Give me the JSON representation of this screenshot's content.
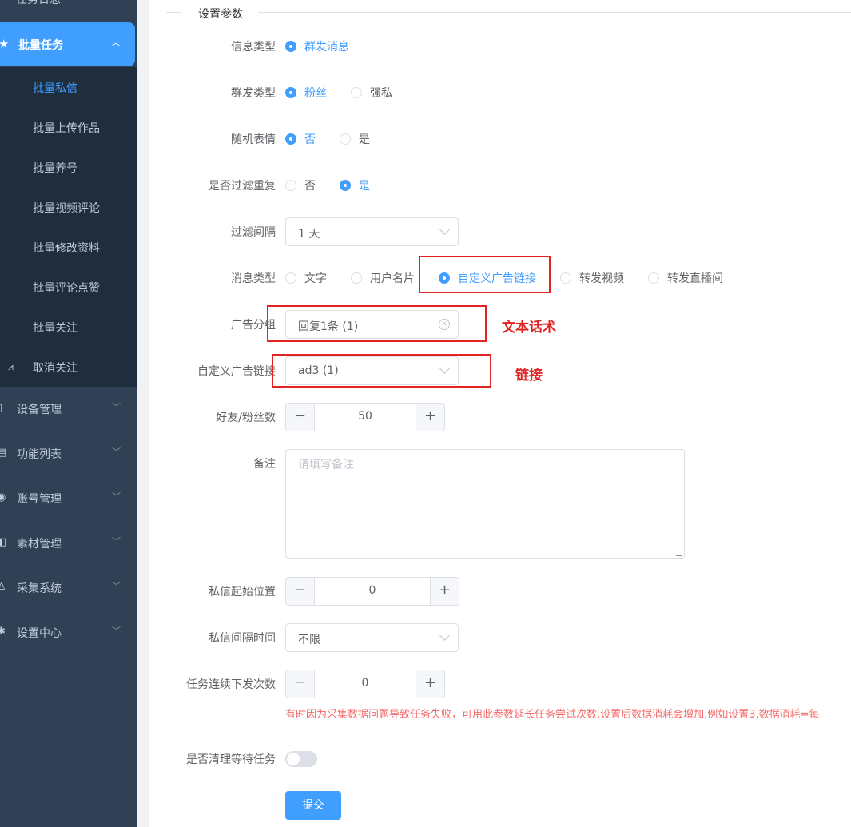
{
  "sidebar": {
    "top_item": "任务日志",
    "active_group": {
      "label": "批量任务",
      "icon": "star-icon"
    },
    "sub_items": [
      {
        "label": "批量私信",
        "current": true
      },
      {
        "label": "批量上传作品"
      },
      {
        "label": "批量养号"
      },
      {
        "label": "批量视频评论"
      },
      {
        "label": "批量修改资料"
      },
      {
        "label": "批量评论点赞"
      },
      {
        "label": "批量关注"
      },
      {
        "label": "取消关注",
        "icon": "unfollow-icon"
      }
    ],
    "groups": [
      {
        "label": "设备管理",
        "icon": "phone-icon"
      },
      {
        "label": "功能列表",
        "icon": "list-icon"
      },
      {
        "label": "账号管理",
        "icon": "user-icon"
      },
      {
        "label": "素材管理",
        "icon": "box-icon"
      },
      {
        "label": "采集系统",
        "icon": "collect-icon"
      },
      {
        "label": "设置中心",
        "icon": "gear-icon"
      }
    ]
  },
  "form": {
    "legend": "设置参数",
    "info_type": {
      "label": "信息类型",
      "options": [
        "群发消息"
      ],
      "selected": "群发消息"
    },
    "mass_type": {
      "label": "群发类型",
      "options": [
        "粉丝",
        "强私"
      ],
      "selected": "粉丝"
    },
    "random_emoji": {
      "label": "随机表情",
      "options": [
        "否",
        "是"
      ],
      "selected": "否"
    },
    "filter_repeat": {
      "label": "是否过滤重复",
      "options": [
        "否",
        "是"
      ],
      "selected": "是"
    },
    "filter_interval": {
      "label": "过滤间隔",
      "value": "1 天"
    },
    "message_type": {
      "label": "消息类型",
      "options": [
        "文字",
        "用户名片",
        "自定义广告链接",
        "转发视频",
        "转发直播间"
      ],
      "selected": "自定义广告链接"
    },
    "ad_group": {
      "label": "广告分组",
      "value": "回复1条 (1)"
    },
    "custom_ad_link": {
      "label": "自定义广告链接",
      "value": "ad3 (1)"
    },
    "friend_fans_count": {
      "label": "好友/粉丝数",
      "value": "50"
    },
    "remark": {
      "label": "备注",
      "placeholder": "请填写备注"
    },
    "dm_start_pos": {
      "label": "私信起始位置",
      "value": "0"
    },
    "dm_interval": {
      "label": "私信间隔时间",
      "value": "不限"
    },
    "task_repeat": {
      "label": "任务连续下发次数",
      "value": "0"
    },
    "hint": "有时因为采集数据问题导致任务失败，可用此参数延长任务尝试次数,设置后数据消耗会增加,例如设置3,数据消耗=每",
    "clear_waiting": {
      "label": "是否清理等待任务",
      "on": false
    },
    "submit": "提交"
  },
  "annotations": {
    "ad_group_note": "文本话术",
    "link_note": "链接",
    "color": "#e02424"
  },
  "colors": {
    "accent": "#409eff",
    "sidebar": "#304156",
    "warning": "#f56c6c"
  }
}
